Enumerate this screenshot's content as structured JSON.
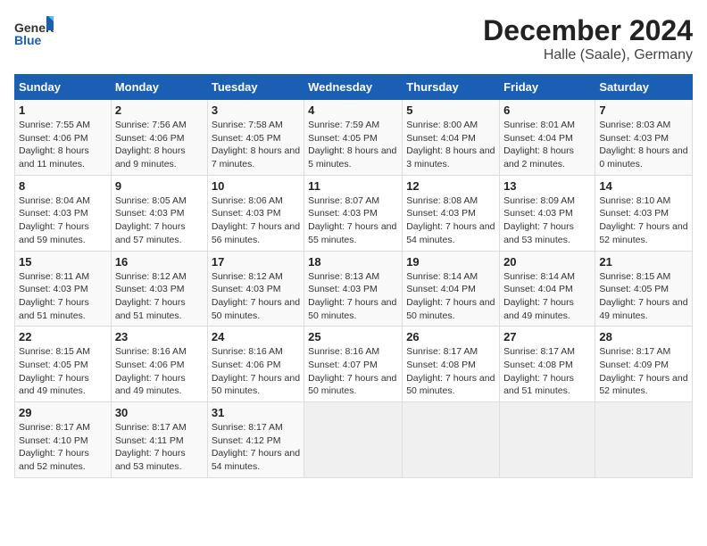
{
  "logo": {
    "general": "General",
    "blue": "Blue"
  },
  "title": "December 2024",
  "subtitle": "Halle (Saale), Germany",
  "days_of_week": [
    "Sunday",
    "Monday",
    "Tuesday",
    "Wednesday",
    "Thursday",
    "Friday",
    "Saturday"
  ],
  "weeks": [
    [
      {
        "day": "1",
        "info": "Sunrise: 7:55 AM\nSunset: 4:06 PM\nDaylight: 8 hours and 11 minutes."
      },
      {
        "day": "2",
        "info": "Sunrise: 7:56 AM\nSunset: 4:06 PM\nDaylight: 8 hours and 9 minutes."
      },
      {
        "day": "3",
        "info": "Sunrise: 7:58 AM\nSunset: 4:05 PM\nDaylight: 8 hours and 7 minutes."
      },
      {
        "day": "4",
        "info": "Sunrise: 7:59 AM\nSunset: 4:05 PM\nDaylight: 8 hours and 5 minutes."
      },
      {
        "day": "5",
        "info": "Sunrise: 8:00 AM\nSunset: 4:04 PM\nDaylight: 8 hours and 3 minutes."
      },
      {
        "day": "6",
        "info": "Sunrise: 8:01 AM\nSunset: 4:04 PM\nDaylight: 8 hours and 2 minutes."
      },
      {
        "day": "7",
        "info": "Sunrise: 8:03 AM\nSunset: 4:03 PM\nDaylight: 8 hours and 0 minutes."
      }
    ],
    [
      {
        "day": "8",
        "info": "Sunrise: 8:04 AM\nSunset: 4:03 PM\nDaylight: 7 hours and 59 minutes."
      },
      {
        "day": "9",
        "info": "Sunrise: 8:05 AM\nSunset: 4:03 PM\nDaylight: 7 hours and 57 minutes."
      },
      {
        "day": "10",
        "info": "Sunrise: 8:06 AM\nSunset: 4:03 PM\nDaylight: 7 hours and 56 minutes."
      },
      {
        "day": "11",
        "info": "Sunrise: 8:07 AM\nSunset: 4:03 PM\nDaylight: 7 hours and 55 minutes."
      },
      {
        "day": "12",
        "info": "Sunrise: 8:08 AM\nSunset: 4:03 PM\nDaylight: 7 hours and 54 minutes."
      },
      {
        "day": "13",
        "info": "Sunrise: 8:09 AM\nSunset: 4:03 PM\nDaylight: 7 hours and 53 minutes."
      },
      {
        "day": "14",
        "info": "Sunrise: 8:10 AM\nSunset: 4:03 PM\nDaylight: 7 hours and 52 minutes."
      }
    ],
    [
      {
        "day": "15",
        "info": "Sunrise: 8:11 AM\nSunset: 4:03 PM\nDaylight: 7 hours and 51 minutes."
      },
      {
        "day": "16",
        "info": "Sunrise: 8:12 AM\nSunset: 4:03 PM\nDaylight: 7 hours and 51 minutes."
      },
      {
        "day": "17",
        "info": "Sunrise: 8:12 AM\nSunset: 4:03 PM\nDaylight: 7 hours and 50 minutes."
      },
      {
        "day": "18",
        "info": "Sunrise: 8:13 AM\nSunset: 4:03 PM\nDaylight: 7 hours and 50 minutes."
      },
      {
        "day": "19",
        "info": "Sunrise: 8:14 AM\nSunset: 4:04 PM\nDaylight: 7 hours and 50 minutes."
      },
      {
        "day": "20",
        "info": "Sunrise: 8:14 AM\nSunset: 4:04 PM\nDaylight: 7 hours and 49 minutes."
      },
      {
        "day": "21",
        "info": "Sunrise: 8:15 AM\nSunset: 4:05 PM\nDaylight: 7 hours and 49 minutes."
      }
    ],
    [
      {
        "day": "22",
        "info": "Sunrise: 8:15 AM\nSunset: 4:05 PM\nDaylight: 7 hours and 49 minutes."
      },
      {
        "day": "23",
        "info": "Sunrise: 8:16 AM\nSunset: 4:06 PM\nDaylight: 7 hours and 49 minutes."
      },
      {
        "day": "24",
        "info": "Sunrise: 8:16 AM\nSunset: 4:06 PM\nDaylight: 7 hours and 50 minutes."
      },
      {
        "day": "25",
        "info": "Sunrise: 8:16 AM\nSunset: 4:07 PM\nDaylight: 7 hours and 50 minutes."
      },
      {
        "day": "26",
        "info": "Sunrise: 8:17 AM\nSunset: 4:08 PM\nDaylight: 7 hours and 50 minutes."
      },
      {
        "day": "27",
        "info": "Sunrise: 8:17 AM\nSunset: 4:08 PM\nDaylight: 7 hours and 51 minutes."
      },
      {
        "day": "28",
        "info": "Sunrise: 8:17 AM\nSunset: 4:09 PM\nDaylight: 7 hours and 52 minutes."
      }
    ],
    [
      {
        "day": "29",
        "info": "Sunrise: 8:17 AM\nSunset: 4:10 PM\nDaylight: 7 hours and 52 minutes."
      },
      {
        "day": "30",
        "info": "Sunrise: 8:17 AM\nSunset: 4:11 PM\nDaylight: 7 hours and 53 minutes."
      },
      {
        "day": "31",
        "info": "Sunrise: 8:17 AM\nSunset: 4:12 PM\nDaylight: 7 hours and 54 minutes."
      },
      {
        "day": "",
        "info": ""
      },
      {
        "day": "",
        "info": ""
      },
      {
        "day": "",
        "info": ""
      },
      {
        "day": "",
        "info": ""
      }
    ]
  ]
}
